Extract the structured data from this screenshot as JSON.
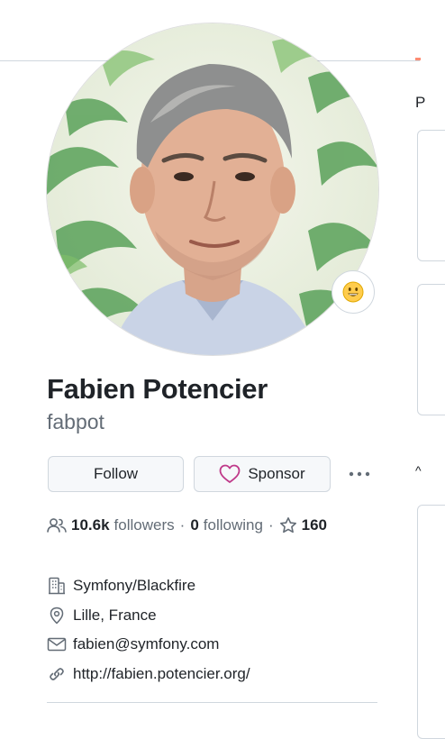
{
  "profile": {
    "full_name": "Fabien Potencier",
    "username": "fabpot",
    "avatar_alt": "avatar",
    "status_emoji": "😀"
  },
  "actions": {
    "follow_label": "Follow",
    "sponsor_label": "Sponsor",
    "more_label": "···"
  },
  "stats": {
    "followers_count": "10.6k",
    "followers_label": "followers",
    "separator": "·",
    "following_count": "0",
    "following_label": "following",
    "stars_count": "160"
  },
  "details": {
    "organization": "Symfony/Blackfire",
    "location": "Lille, France",
    "email": "fabien@symfony.com",
    "website": "http://fabien.potencier.org/"
  },
  "right_column": {
    "letter": "P",
    "mark": "^"
  },
  "colors": {
    "text": "#1f2328",
    "muted": "#636c76",
    "border": "#d0d7de",
    "button_bg": "#f6f8fa",
    "sponsor_heart": "#bf3989",
    "tab_accent": "#fd8c73"
  }
}
